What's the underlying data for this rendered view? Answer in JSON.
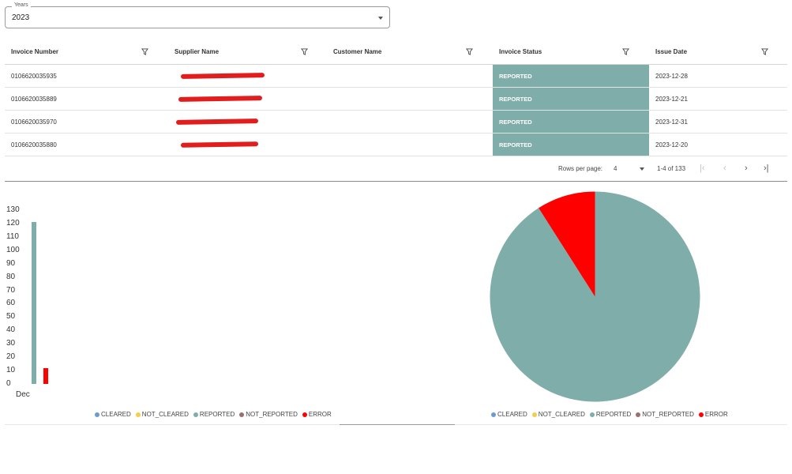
{
  "years": {
    "label": "Years",
    "value": "2023"
  },
  "table": {
    "headers": [
      "Invoice Number",
      "Supplier Name",
      "Customer Name",
      "Invoice Status",
      "Issue Date"
    ],
    "rows": [
      {
        "invoice": "0106620035935",
        "status": "REPORTED",
        "date": "2023-12-28"
      },
      {
        "invoice": "0106620035889",
        "status": "REPORTED",
        "date": "2023-12-21"
      },
      {
        "invoice": "0106620035970",
        "status": "REPORTED",
        "date": "2023-12-31"
      },
      {
        "invoice": "0106620035880",
        "status": "REPORTED",
        "date": "2023-12-20"
      }
    ]
  },
  "pagination": {
    "rows_per_page_label": "Rows per page:",
    "rows_per_page": "4",
    "range": "1-4 of 133"
  },
  "colors": {
    "reported": "#7faeaa",
    "error": "#ff0000",
    "cleared": "#6b9bd1",
    "not_cleared": "#f5cd4b",
    "not_reported": "#9c6f6f"
  },
  "chart_data": [
    {
      "type": "bar",
      "categories": [
        "Dec"
      ],
      "series": [
        {
          "name": "REPORTED",
          "values": [
            121
          ]
        },
        {
          "name": "ERROR",
          "values": [
            12
          ]
        }
      ],
      "yticks": [
        0,
        10,
        20,
        30,
        40,
        50,
        60,
        70,
        80,
        90,
        100,
        110,
        120,
        130
      ],
      "ylim": [
        0,
        130
      ],
      "legend": [
        "CLEARED",
        "NOT_CLEARED",
        "REPORTED",
        "NOT_REPORTED",
        "ERROR"
      ],
      "legend_position": "bottom"
    },
    {
      "type": "pie",
      "labels": [
        "REPORTED",
        "ERROR"
      ],
      "values": [
        121,
        12
      ],
      "legend": [
        "CLEARED",
        "NOT_CLEARED",
        "REPORTED",
        "NOT_REPORTED",
        "ERROR"
      ],
      "legend_position": "bottom"
    }
  ]
}
